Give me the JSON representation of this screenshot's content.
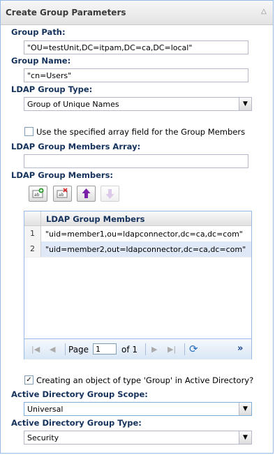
{
  "panel": {
    "title": "Create Group Parameters"
  },
  "group_path": {
    "label": "Group Path:",
    "value": "\"OU=testUnit,DC=itpam,DC=ca,DC=local\""
  },
  "group_name": {
    "label": "Group Name:",
    "value": "\"cn=Users\""
  },
  "ldap_group_type": {
    "label": "LDAP Group Type:",
    "value": "Group of Unique Names"
  },
  "use_array": {
    "label": "Use the specified array field for the Group Members",
    "checked": false
  },
  "members_array": {
    "label": "LDAP Group Members Array:",
    "value": ""
  },
  "members": {
    "label": "LDAP Group Members:",
    "column": "LDAP Group Members",
    "rows": [
      {
        "num": "1",
        "value": "\"uid=member1,ou=ldapconnector,dc=ca,dc=com\""
      },
      {
        "num": "2",
        "value": "\"uid=member2,out=ldapconnector,dc=ca,dc=com\""
      }
    ],
    "paging": {
      "page_label": "Page",
      "page": "1",
      "of_label": "of 1"
    }
  },
  "ad_group": {
    "label": "Creating an object of type 'Group' in Active Directory?",
    "checked": true
  },
  "ad_scope": {
    "label": "Active Directory Group Scope:",
    "value": "Universal"
  },
  "ad_type": {
    "label": "Active Directory Group Type:",
    "value": "Security"
  },
  "colors": {
    "label": "#15325c",
    "border": "#99bbe8",
    "selected_row": "#dfe8f6"
  }
}
